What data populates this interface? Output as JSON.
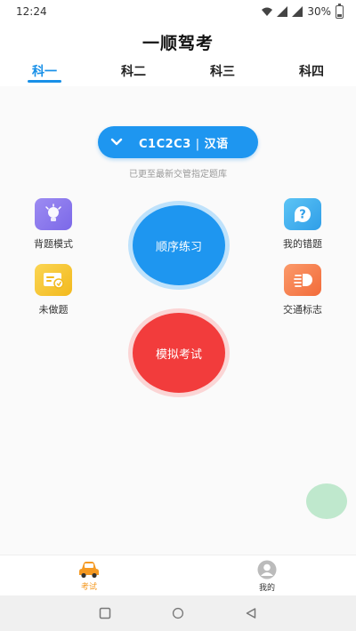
{
  "status_bar": {
    "time": "12:24",
    "battery": "30%"
  },
  "app": {
    "title": "一顺驾考"
  },
  "tabs": [
    {
      "label": "科一",
      "active": true
    },
    {
      "label": "科二",
      "active": false
    },
    {
      "label": "科三",
      "active": false
    },
    {
      "label": "科四",
      "active": false
    }
  ],
  "license": {
    "type": "C1C2C3",
    "language": "汉语",
    "separator": "|"
  },
  "update_note": "已更至最新交管指定题库",
  "features": {
    "recite": "背题模式",
    "mistakes": "我的错题",
    "undone": "未做题",
    "traffic_signs": "交通标志"
  },
  "actions": {
    "sequential": "顺序练习",
    "mock_exam": "模拟考试"
  },
  "bottom_nav": [
    {
      "label": "考试",
      "icon": "car-icon",
      "active": true
    },
    {
      "label": "我的",
      "icon": "user-icon",
      "active": false
    }
  ],
  "colors": {
    "accent_blue": "#1e96f0",
    "exam_red": "#f23c3c",
    "active_orange": "#f59a23"
  }
}
